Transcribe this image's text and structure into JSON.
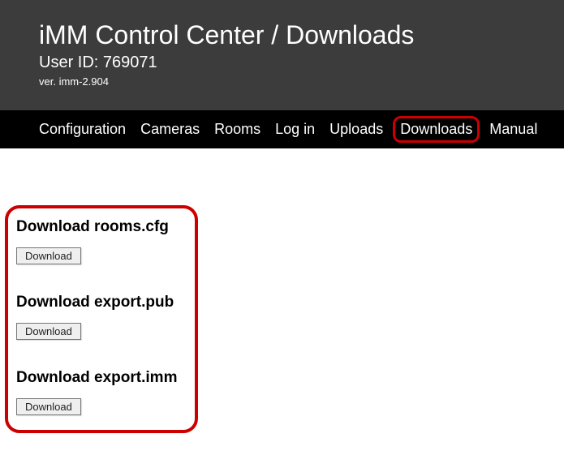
{
  "header": {
    "title": "iMM Control Center / Downloads",
    "user_id": "User ID: 769071",
    "version": "ver. imm-2.904"
  },
  "nav": {
    "items": [
      "Configuration",
      "Cameras",
      "Rooms",
      "Log in",
      "Uploads",
      "Downloads",
      "Manual"
    ],
    "active_index": 5
  },
  "downloads": {
    "sections": [
      {
        "title": "Download rooms.cfg",
        "button": "Download"
      },
      {
        "title": "Download export.pub",
        "button": "Download"
      },
      {
        "title": "Download export.imm",
        "button": "Download"
      }
    ]
  }
}
